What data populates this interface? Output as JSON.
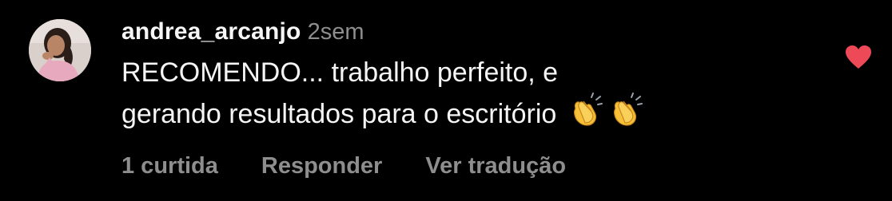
{
  "comment": {
    "username": "andrea_arcanjo",
    "time": "2sem",
    "text_line_1": "RECOMENDO... trabalho perfeito, e",
    "text_line_2": "gerando resultados para o escritório",
    "emojis": [
      "clapping-hands",
      "clapping-hands"
    ],
    "liked": true
  },
  "actions": {
    "likes": "1 curtida",
    "reply": "Responder",
    "translate": "Ver tradução"
  },
  "colors": {
    "background": "#000000",
    "text": "#f5f5f5",
    "muted": "#8e8e8e",
    "like": "#ed4956"
  }
}
